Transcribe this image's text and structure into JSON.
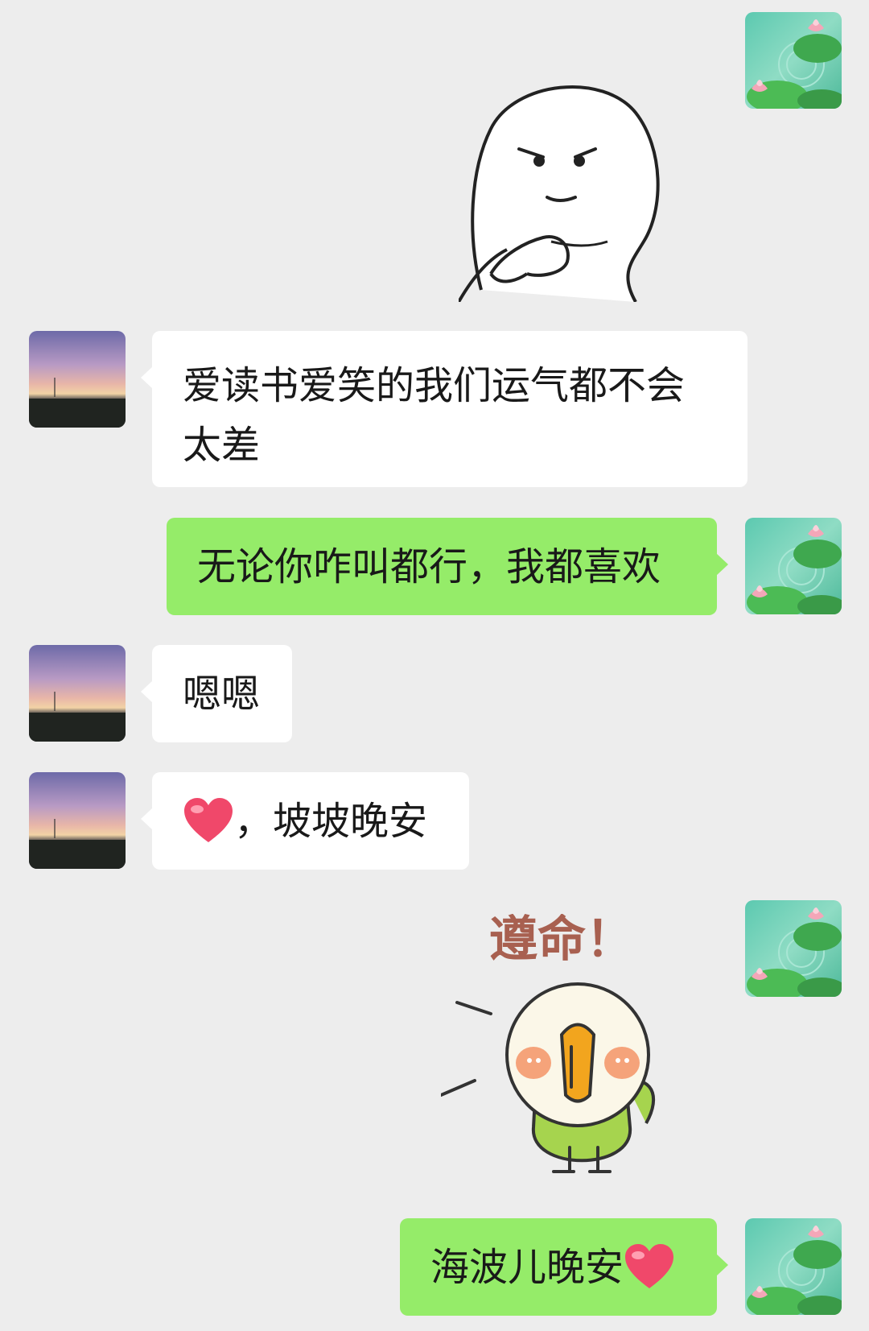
{
  "chat": {
    "messages": [
      {
        "id": "m1",
        "sender": "me",
        "type": "sticker",
        "sticker": "smug-face-sticker"
      },
      {
        "id": "m2",
        "sender": "friend",
        "type": "text",
        "text": "爱读书爱笑的我们运气都不会太差"
      },
      {
        "id": "m3",
        "sender": "me",
        "type": "text",
        "text": "无论你咋叫都行，我都喜欢"
      },
      {
        "id": "m4",
        "sender": "friend",
        "type": "text",
        "text": "嗯嗯"
      },
      {
        "id": "m5",
        "sender": "friend",
        "type": "text",
        "text_after_emoji": "，坡坡晚安",
        "emoji": "red-heart"
      },
      {
        "id": "m6",
        "sender": "me",
        "type": "sticker",
        "sticker": "parrot-sticker",
        "caption": "遵命！"
      },
      {
        "id": "m7",
        "sender": "me",
        "type": "text",
        "text": "海波儿晚安",
        "emoji": "red-heart"
      }
    ]
  },
  "avatars": {
    "me": "lotus-pond-avatar",
    "friend": "sunset-field-avatar"
  },
  "colors": {
    "background": "#ededed",
    "incoming_bubble": "#ffffff",
    "outgoing_bubble": "#95ec69",
    "text": "#191919"
  }
}
